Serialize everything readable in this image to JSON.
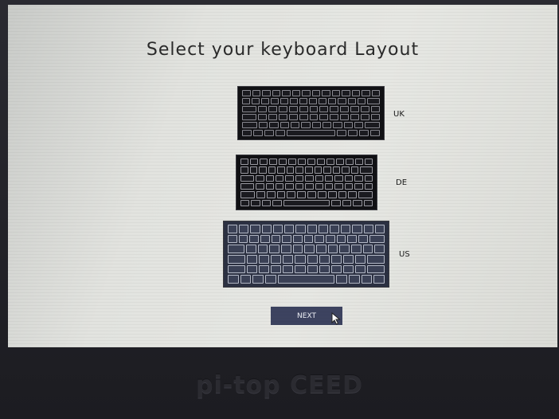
{
  "screen": {
    "title": "Select your keyboard Layout"
  },
  "layouts": [
    {
      "label": "UK"
    },
    {
      "label": "DE"
    },
    {
      "label": "US"
    }
  ],
  "next_button": {
    "label": "NEXT"
  },
  "bezel": {
    "brand": "pi-top CEED"
  },
  "colors": {
    "screen_background": "#e2e3df",
    "title_text": "#2a2a2a",
    "keyboard_dark": "#111114",
    "keyboard_us": "#2c3142",
    "button_background": "#3d4360",
    "button_text": "#eef0f6",
    "bezel": "#1e1e24"
  },
  "icons": {
    "cursor": "arrow-cursor-icon"
  }
}
